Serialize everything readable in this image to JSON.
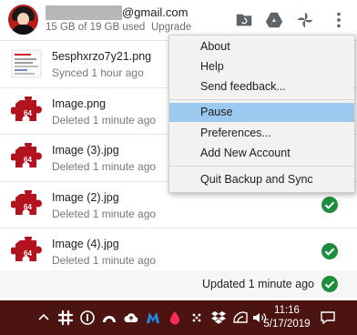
{
  "header": {
    "email_suffix": "@gmail.com",
    "storage": "15 GB of 19 GB used",
    "upgrade_label": "Upgrade",
    "icons": [
      "folder-sync-icon",
      "google-drive-icon",
      "google-photos-icon",
      "more-vert-icon"
    ]
  },
  "files": [
    {
      "name": "5esphxrzo7y21.png",
      "status": "Synced 1 hour ago",
      "thumb": "screenshot-thumbnail",
      "checked": false
    },
    {
      "name": "Image.png",
      "status": "Deleted 1 minute ago",
      "thumb": "puzzle-64-thumbnail",
      "checked": false
    },
    {
      "name": "Image (3).jpg",
      "status": "Deleted 1 minute ago",
      "thumb": "puzzle-64-thumbnail",
      "checked": false
    },
    {
      "name": "Image (2).jpg",
      "status": "Deleted 1 minute ago",
      "thumb": "puzzle-64-thumbnail",
      "checked": true
    },
    {
      "name": "Image (4).jpg",
      "status": "Deleted 1 minute ago",
      "thumb": "puzzle-64-thumbnail",
      "checked": true
    }
  ],
  "thumb_badge": "64",
  "footer": {
    "status": "Updated 1 minute ago"
  },
  "menu": {
    "items": [
      "About",
      "Help",
      "Send feedback...",
      "Pause",
      "Preferences...",
      "Add New Account",
      "Quit Backup and Sync"
    ],
    "active": "Pause"
  },
  "taskbar": {
    "time": "11:16",
    "date": "5/17/2019",
    "tray_icons": [
      "chevron-up-icon",
      "slack-icon",
      "onepassword-icon",
      "chrome-remote-icon",
      "backup-sync-cloud-icon",
      "malwarebytes-icon",
      "drop-icon",
      "dots-icon",
      "dropbox-icon",
      "wifi-icon",
      "volume-icon",
      "notifications-icon"
    ]
  },
  "colors": {
    "check_green": "#1e8e3e",
    "menu_highlight": "#9cc9f0",
    "taskbar_bg": "#4b1410",
    "puzzle_red": "#b3121f"
  }
}
